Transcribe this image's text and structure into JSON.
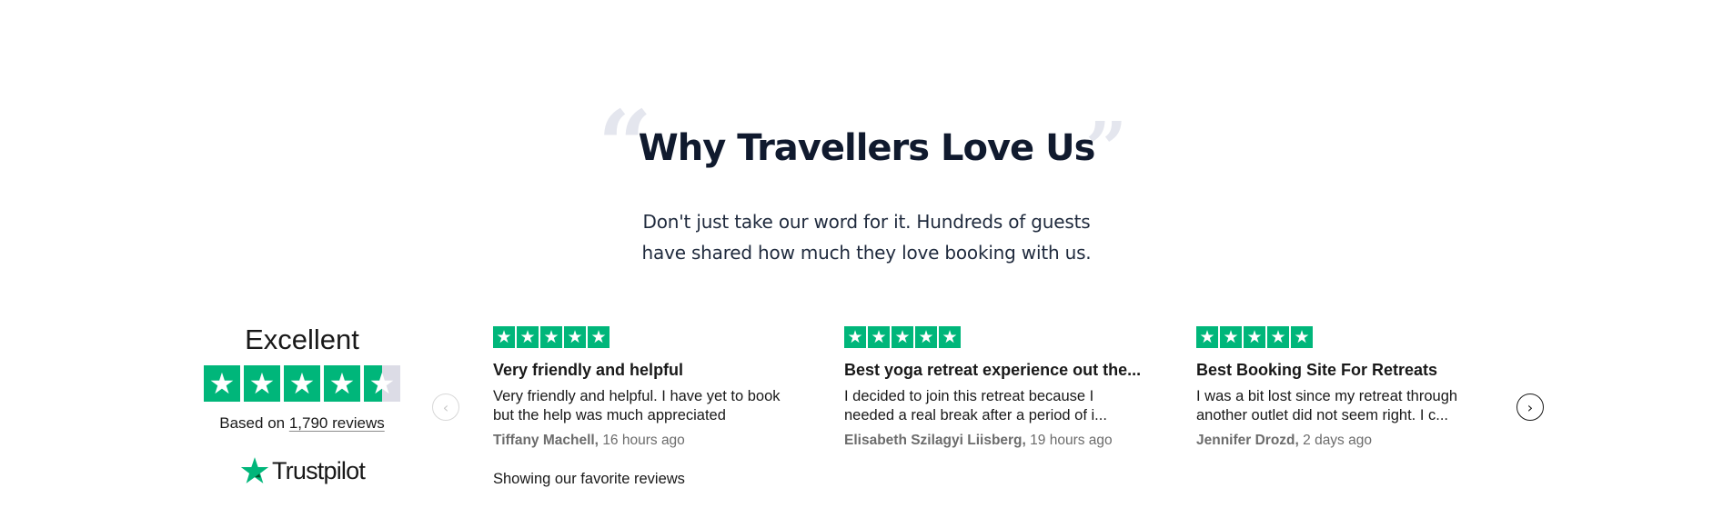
{
  "heading": {
    "open_quote": "“",
    "close_quote": "”",
    "title": "Why Travellers Love Us",
    "subtitle_line1": "Don't just take our word for it. Hundreds of guests",
    "subtitle_line2": "have shared how much they love booking with us."
  },
  "summary": {
    "rating_label": "Excellent",
    "stars": 4.5,
    "based_on_prefix": "Based on ",
    "reviews_link": "1,790 reviews",
    "brand": "Trustpilot",
    "brand_color": "#00b67a"
  },
  "carousel": {
    "prev_icon": "chevron-left-icon",
    "next_icon": "chevron-right-icon",
    "prev_glyph": "‹",
    "next_glyph": "›"
  },
  "reviews": [
    {
      "stars": 5,
      "title": "Very friendly and helpful",
      "body_line1": "Very friendly and helpful. I have yet to book",
      "body_line2": "but the help was much appreciated",
      "author": "Tiffany Machell,",
      "time": "16 hours ago"
    },
    {
      "stars": 5,
      "title": "Best yoga retreat experience out the...",
      "body_line1": "I decided to join this retreat because I",
      "body_line2": "needed a real break after a period of i...",
      "author": "Elisabeth Szilagyi Liisberg,",
      "time": "19 hours ago"
    },
    {
      "stars": 5,
      "title": "Best Booking Site For Retreats",
      "body_line1": "I was a bit lost since my retreat through",
      "body_line2": "another outlet did not seem right. I c...",
      "author": "Jennifer Drozd,",
      "time": "2 days ago"
    }
  ],
  "footer_note": "Showing our favorite reviews"
}
